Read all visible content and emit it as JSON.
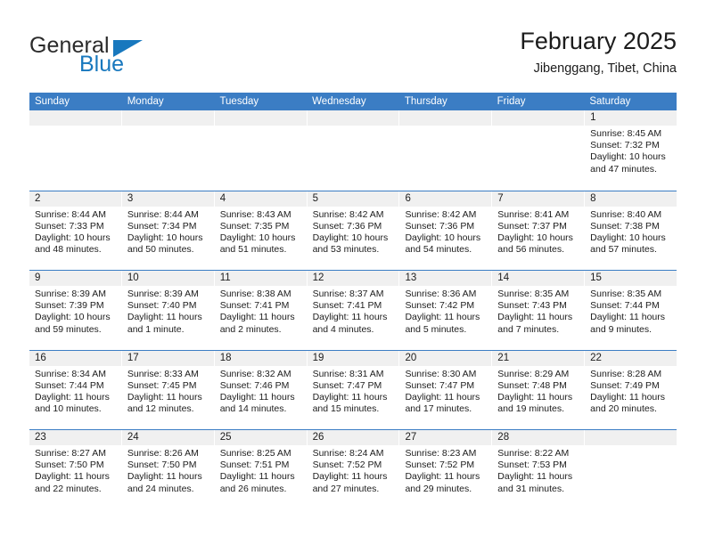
{
  "brand": {
    "name_part1": "General",
    "name_part2": "Blue",
    "accent_color": "#1878be"
  },
  "header": {
    "title": "February 2025",
    "location": "Jibenggang, Tibet, China"
  },
  "calendar": {
    "header_color": "#3b7dc4",
    "band_color": "#f0f0f0",
    "weekdays": [
      "Sunday",
      "Monday",
      "Tuesday",
      "Wednesday",
      "Thursday",
      "Friday",
      "Saturday"
    ],
    "weeks": [
      [
        {
          "empty": true
        },
        {
          "empty": true
        },
        {
          "empty": true
        },
        {
          "empty": true
        },
        {
          "empty": true
        },
        {
          "empty": true
        },
        {
          "day": "1",
          "sunrise": "Sunrise: 8:45 AM",
          "sunset": "Sunset: 7:32 PM",
          "daylight": "Daylight: 10 hours and 47 minutes."
        }
      ],
      [
        {
          "day": "2",
          "sunrise": "Sunrise: 8:44 AM",
          "sunset": "Sunset: 7:33 PM",
          "daylight": "Daylight: 10 hours and 48 minutes."
        },
        {
          "day": "3",
          "sunrise": "Sunrise: 8:44 AM",
          "sunset": "Sunset: 7:34 PM",
          "daylight": "Daylight: 10 hours and 50 minutes."
        },
        {
          "day": "4",
          "sunrise": "Sunrise: 8:43 AM",
          "sunset": "Sunset: 7:35 PM",
          "daylight": "Daylight: 10 hours and 51 minutes."
        },
        {
          "day": "5",
          "sunrise": "Sunrise: 8:42 AM",
          "sunset": "Sunset: 7:36 PM",
          "daylight": "Daylight: 10 hours and 53 minutes."
        },
        {
          "day": "6",
          "sunrise": "Sunrise: 8:42 AM",
          "sunset": "Sunset: 7:36 PM",
          "daylight": "Daylight: 10 hours and 54 minutes."
        },
        {
          "day": "7",
          "sunrise": "Sunrise: 8:41 AM",
          "sunset": "Sunset: 7:37 PM",
          "daylight": "Daylight: 10 hours and 56 minutes."
        },
        {
          "day": "8",
          "sunrise": "Sunrise: 8:40 AM",
          "sunset": "Sunset: 7:38 PM",
          "daylight": "Daylight: 10 hours and 57 minutes."
        }
      ],
      [
        {
          "day": "9",
          "sunrise": "Sunrise: 8:39 AM",
          "sunset": "Sunset: 7:39 PM",
          "daylight": "Daylight: 10 hours and 59 minutes."
        },
        {
          "day": "10",
          "sunrise": "Sunrise: 8:39 AM",
          "sunset": "Sunset: 7:40 PM",
          "daylight": "Daylight: 11 hours and 1 minute."
        },
        {
          "day": "11",
          "sunrise": "Sunrise: 8:38 AM",
          "sunset": "Sunset: 7:41 PM",
          "daylight": "Daylight: 11 hours and 2 minutes."
        },
        {
          "day": "12",
          "sunrise": "Sunrise: 8:37 AM",
          "sunset": "Sunset: 7:41 PM",
          "daylight": "Daylight: 11 hours and 4 minutes."
        },
        {
          "day": "13",
          "sunrise": "Sunrise: 8:36 AM",
          "sunset": "Sunset: 7:42 PM",
          "daylight": "Daylight: 11 hours and 5 minutes."
        },
        {
          "day": "14",
          "sunrise": "Sunrise: 8:35 AM",
          "sunset": "Sunset: 7:43 PM",
          "daylight": "Daylight: 11 hours and 7 minutes."
        },
        {
          "day": "15",
          "sunrise": "Sunrise: 8:35 AM",
          "sunset": "Sunset: 7:44 PM",
          "daylight": "Daylight: 11 hours and 9 minutes."
        }
      ],
      [
        {
          "day": "16",
          "sunrise": "Sunrise: 8:34 AM",
          "sunset": "Sunset: 7:44 PM",
          "daylight": "Daylight: 11 hours and 10 minutes."
        },
        {
          "day": "17",
          "sunrise": "Sunrise: 8:33 AM",
          "sunset": "Sunset: 7:45 PM",
          "daylight": "Daylight: 11 hours and 12 minutes."
        },
        {
          "day": "18",
          "sunrise": "Sunrise: 8:32 AM",
          "sunset": "Sunset: 7:46 PM",
          "daylight": "Daylight: 11 hours and 14 minutes."
        },
        {
          "day": "19",
          "sunrise": "Sunrise: 8:31 AM",
          "sunset": "Sunset: 7:47 PM",
          "daylight": "Daylight: 11 hours and 15 minutes."
        },
        {
          "day": "20",
          "sunrise": "Sunrise: 8:30 AM",
          "sunset": "Sunset: 7:47 PM",
          "daylight": "Daylight: 11 hours and 17 minutes."
        },
        {
          "day": "21",
          "sunrise": "Sunrise: 8:29 AM",
          "sunset": "Sunset: 7:48 PM",
          "daylight": "Daylight: 11 hours and 19 minutes."
        },
        {
          "day": "22",
          "sunrise": "Sunrise: 8:28 AM",
          "sunset": "Sunset: 7:49 PM",
          "daylight": "Daylight: 11 hours and 20 minutes."
        }
      ],
      [
        {
          "day": "23",
          "sunrise": "Sunrise: 8:27 AM",
          "sunset": "Sunset: 7:50 PM",
          "daylight": "Daylight: 11 hours and 22 minutes."
        },
        {
          "day": "24",
          "sunrise": "Sunrise: 8:26 AM",
          "sunset": "Sunset: 7:50 PM",
          "daylight": "Daylight: 11 hours and 24 minutes."
        },
        {
          "day": "25",
          "sunrise": "Sunrise: 8:25 AM",
          "sunset": "Sunset: 7:51 PM",
          "daylight": "Daylight: 11 hours and 26 minutes."
        },
        {
          "day": "26",
          "sunrise": "Sunrise: 8:24 AM",
          "sunset": "Sunset: 7:52 PM",
          "daylight": "Daylight: 11 hours and 27 minutes."
        },
        {
          "day": "27",
          "sunrise": "Sunrise: 8:23 AM",
          "sunset": "Sunset: 7:52 PM",
          "daylight": "Daylight: 11 hours and 29 minutes."
        },
        {
          "day": "28",
          "sunrise": "Sunrise: 8:22 AM",
          "sunset": "Sunset: 7:53 PM",
          "daylight": "Daylight: 11 hours and 31 minutes."
        },
        {
          "empty": true
        }
      ]
    ]
  }
}
